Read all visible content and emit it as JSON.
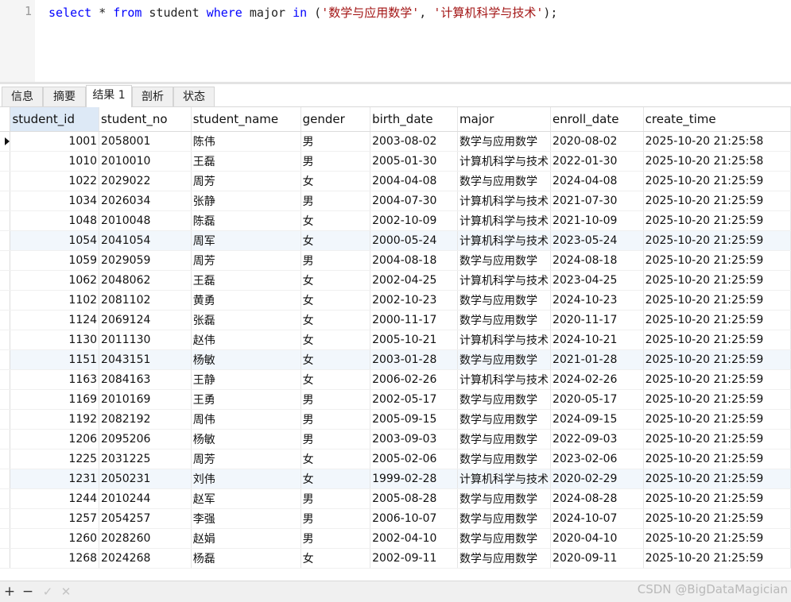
{
  "editor": {
    "line_number": "1",
    "tokens": [
      {
        "text": "select",
        "kind": "kw"
      },
      {
        "text": " * ",
        "kind": "plain"
      },
      {
        "text": "from",
        "kind": "kw"
      },
      {
        "text": " student ",
        "kind": "plain"
      },
      {
        "text": "where",
        "kind": "kw"
      },
      {
        "text": " major ",
        "kind": "plain"
      },
      {
        "text": "in",
        "kind": "kw"
      },
      {
        "text": " (",
        "kind": "plain"
      },
      {
        "text": "'数学与应用数学'",
        "kind": "str"
      },
      {
        "text": ", ",
        "kind": "plain"
      },
      {
        "text": "'计算机科学与技术'",
        "kind": "str"
      },
      {
        "text": ");",
        "kind": "plain"
      }
    ]
  },
  "tabs": [
    {
      "label": "信息",
      "active": false
    },
    {
      "label": "摘要",
      "active": false
    },
    {
      "label": "结果 1",
      "active": true
    },
    {
      "label": "剖析",
      "active": false
    },
    {
      "label": "状态",
      "active": false
    }
  ],
  "grid": {
    "columns": [
      "student_id",
      "student_no",
      "student_name",
      "gender",
      "birth_date",
      "major",
      "enroll_date",
      "create_time"
    ],
    "selected_column": "student_id",
    "rows": [
      [
        "1001",
        "2058001",
        "陈伟",
        "男",
        "2003-08-02",
        "数学与应用数学",
        "2020-08-02",
        "2025-10-20 21:25:58"
      ],
      [
        "1010",
        "2010010",
        "王磊",
        "男",
        "2005-01-30",
        "计算机科学与技术",
        "2022-01-30",
        "2025-10-20 21:25:58"
      ],
      [
        "1022",
        "2029022",
        "周芳",
        "女",
        "2004-04-08",
        "数学与应用数学",
        "2024-04-08",
        "2025-10-20 21:25:59"
      ],
      [
        "1034",
        "2026034",
        "张静",
        "男",
        "2004-07-30",
        "计算机科学与技术",
        "2021-07-30",
        "2025-10-20 21:25:59"
      ],
      [
        "1048",
        "2010048",
        "陈磊",
        "女",
        "2002-10-09",
        "计算机科学与技术",
        "2021-10-09",
        "2025-10-20 21:25:59"
      ],
      [
        "1054",
        "2041054",
        "周军",
        "女",
        "2000-05-24",
        "计算机科学与技术",
        "2023-05-24",
        "2025-10-20 21:25:59"
      ],
      [
        "1059",
        "2029059",
        "周芳",
        "男",
        "2004-08-18",
        "数学与应用数学",
        "2024-08-18",
        "2025-10-20 21:25:59"
      ],
      [
        "1062",
        "2048062",
        "王磊",
        "女",
        "2002-04-25",
        "计算机科学与技术",
        "2023-04-25",
        "2025-10-20 21:25:59"
      ],
      [
        "1102",
        "2081102",
        "黄勇",
        "女",
        "2002-10-23",
        "数学与应用数学",
        "2024-10-23",
        "2025-10-20 21:25:59"
      ],
      [
        "1124",
        "2069124",
        "张磊",
        "女",
        "2000-11-17",
        "数学与应用数学",
        "2020-11-17",
        "2025-10-20 21:25:59"
      ],
      [
        "1130",
        "2011130",
        "赵伟",
        "女",
        "2005-10-21",
        "计算机科学与技术",
        "2024-10-21",
        "2025-10-20 21:25:59"
      ],
      [
        "1151",
        "2043151",
        "杨敏",
        "女",
        "2003-01-28",
        "数学与应用数学",
        "2021-01-28",
        "2025-10-20 21:25:59"
      ],
      [
        "1163",
        "2084163",
        "王静",
        "女",
        "2006-02-26",
        "计算机科学与技术",
        "2024-02-26",
        "2025-10-20 21:25:59"
      ],
      [
        "1169",
        "2010169",
        "王勇",
        "男",
        "2002-05-17",
        "数学与应用数学",
        "2020-05-17",
        "2025-10-20 21:25:59"
      ],
      [
        "1192",
        "2082192",
        "周伟",
        "男",
        "2005-09-15",
        "数学与应用数学",
        "2024-09-15",
        "2025-10-20 21:25:59"
      ],
      [
        "1206",
        "2095206",
        "杨敏",
        "男",
        "2003-09-03",
        "数学与应用数学",
        "2022-09-03",
        "2025-10-20 21:25:59"
      ],
      [
        "1225",
        "2031225",
        "周芳",
        "女",
        "2005-02-06",
        "数学与应用数学",
        "2023-02-06",
        "2025-10-20 21:25:59"
      ],
      [
        "1231",
        "2050231",
        "刘伟",
        "女",
        "1999-02-28",
        "计算机科学与技术",
        "2020-02-29",
        "2025-10-20 21:25:59"
      ],
      [
        "1244",
        "2010244",
        "赵军",
        "男",
        "2005-08-28",
        "数学与应用数学",
        "2024-08-28",
        "2025-10-20 21:25:59"
      ],
      [
        "1257",
        "2054257",
        "李强",
        "男",
        "2006-10-07",
        "数学与应用数学",
        "2024-10-07",
        "2025-10-20 21:25:59"
      ],
      [
        "1260",
        "2028260",
        "赵娟",
        "男",
        "2002-04-10",
        "数学与应用数学",
        "2020-04-10",
        "2025-10-20 21:25:59"
      ],
      [
        "1268",
        "2024268",
        "杨磊",
        "女",
        "2002-09-11",
        "数学与应用数学",
        "2020-09-11",
        "2025-10-20 21:25:59"
      ]
    ],
    "highlighted_rows": [
      5,
      11,
      17
    ],
    "current_row": 0
  },
  "toolbar": {
    "add_label": "+",
    "delete_label": "−",
    "apply_label": "✓",
    "cancel_label": "✕"
  },
  "watermark": "CSDN @BigDataMagician",
  "colors": {
    "keyword": "#0000ff",
    "string": "#a31515",
    "selected_header": "#dde9f6",
    "highlighted_row": "#f2f7fc"
  }
}
